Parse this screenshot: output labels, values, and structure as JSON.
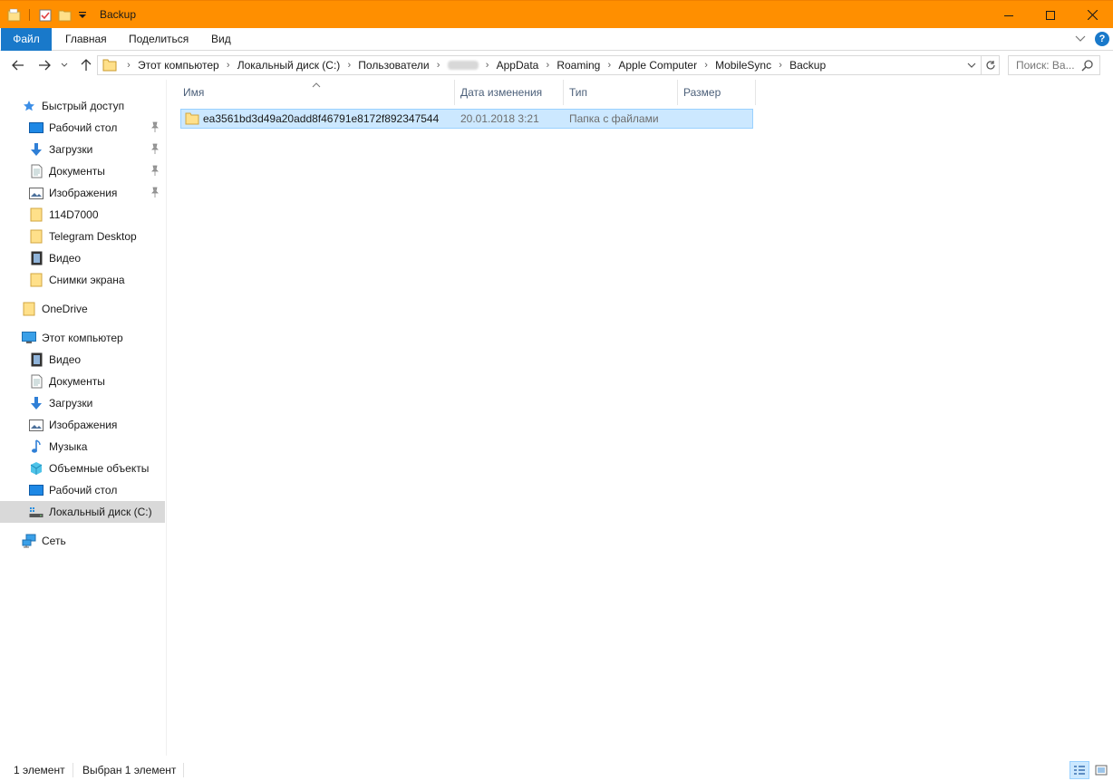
{
  "window": {
    "title": "Backup",
    "accent_color": "#ff8f00"
  },
  "ribbon": {
    "tabs": [
      {
        "label": "Файл"
      },
      {
        "label": "Главная"
      },
      {
        "label": "Поделиться"
      },
      {
        "label": "Вид"
      }
    ],
    "file_tab_color": "#1979ca"
  },
  "address": {
    "crumbs": [
      "Этот компьютер",
      "Локальный диск (C:)",
      "Пользователи",
      "AppData",
      "Roaming",
      "Apple Computer",
      "MobileSync",
      "Backup"
    ],
    "search_placeholder": "Поиск: Ва..."
  },
  "navigation": {
    "quick_access": {
      "label": "Быстрый доступ",
      "items": [
        {
          "label": "Рабочий стол",
          "icon": "desktop-icon",
          "pinned": true
        },
        {
          "label": "Загрузки",
          "icon": "downloads-icon",
          "pinned": true
        },
        {
          "label": "Документы",
          "icon": "documents-icon",
          "pinned": true
        },
        {
          "label": "Изображения",
          "icon": "pictures-icon",
          "pinned": true
        },
        {
          "label": "114D7000",
          "icon": "folder-icon",
          "pinned": false
        },
        {
          "label": "Telegram Desktop",
          "icon": "folder-icon",
          "pinned": false
        },
        {
          "label": "Видео",
          "icon": "video-icon",
          "pinned": false
        },
        {
          "label": "Снимки экрана",
          "icon": "folder-icon",
          "pinned": false
        }
      ]
    },
    "onedrive": {
      "label": "OneDrive"
    },
    "this_pc": {
      "label": "Этот компьютер",
      "items": [
        {
          "label": "Видео",
          "icon": "video-icon"
        },
        {
          "label": "Документы",
          "icon": "documents-icon"
        },
        {
          "label": "Загрузки",
          "icon": "downloads-icon"
        },
        {
          "label": "Изображения",
          "icon": "pictures-icon"
        },
        {
          "label": "Музыка",
          "icon": "music-icon"
        },
        {
          "label": "Объемные объекты",
          "icon": "3d-objects-icon"
        },
        {
          "label": "Рабочий стол",
          "icon": "desktop-icon"
        },
        {
          "label": "Локальный диск (C:)",
          "icon": "drive-icon",
          "selected": true
        }
      ]
    },
    "network": {
      "label": "Сеть"
    }
  },
  "file_list": {
    "columns": [
      "Имя",
      "Дата изменения",
      "Тип",
      "Размер"
    ],
    "rows": [
      {
        "name": "ea3561bd3d49a20add8f46791e8172f892347544",
        "date": "20.01.2018 3:21",
        "type": "Папка с файлами",
        "size": ""
      }
    ]
  },
  "status": {
    "count": "1 элемент",
    "selected": "Выбран 1 элемент"
  }
}
